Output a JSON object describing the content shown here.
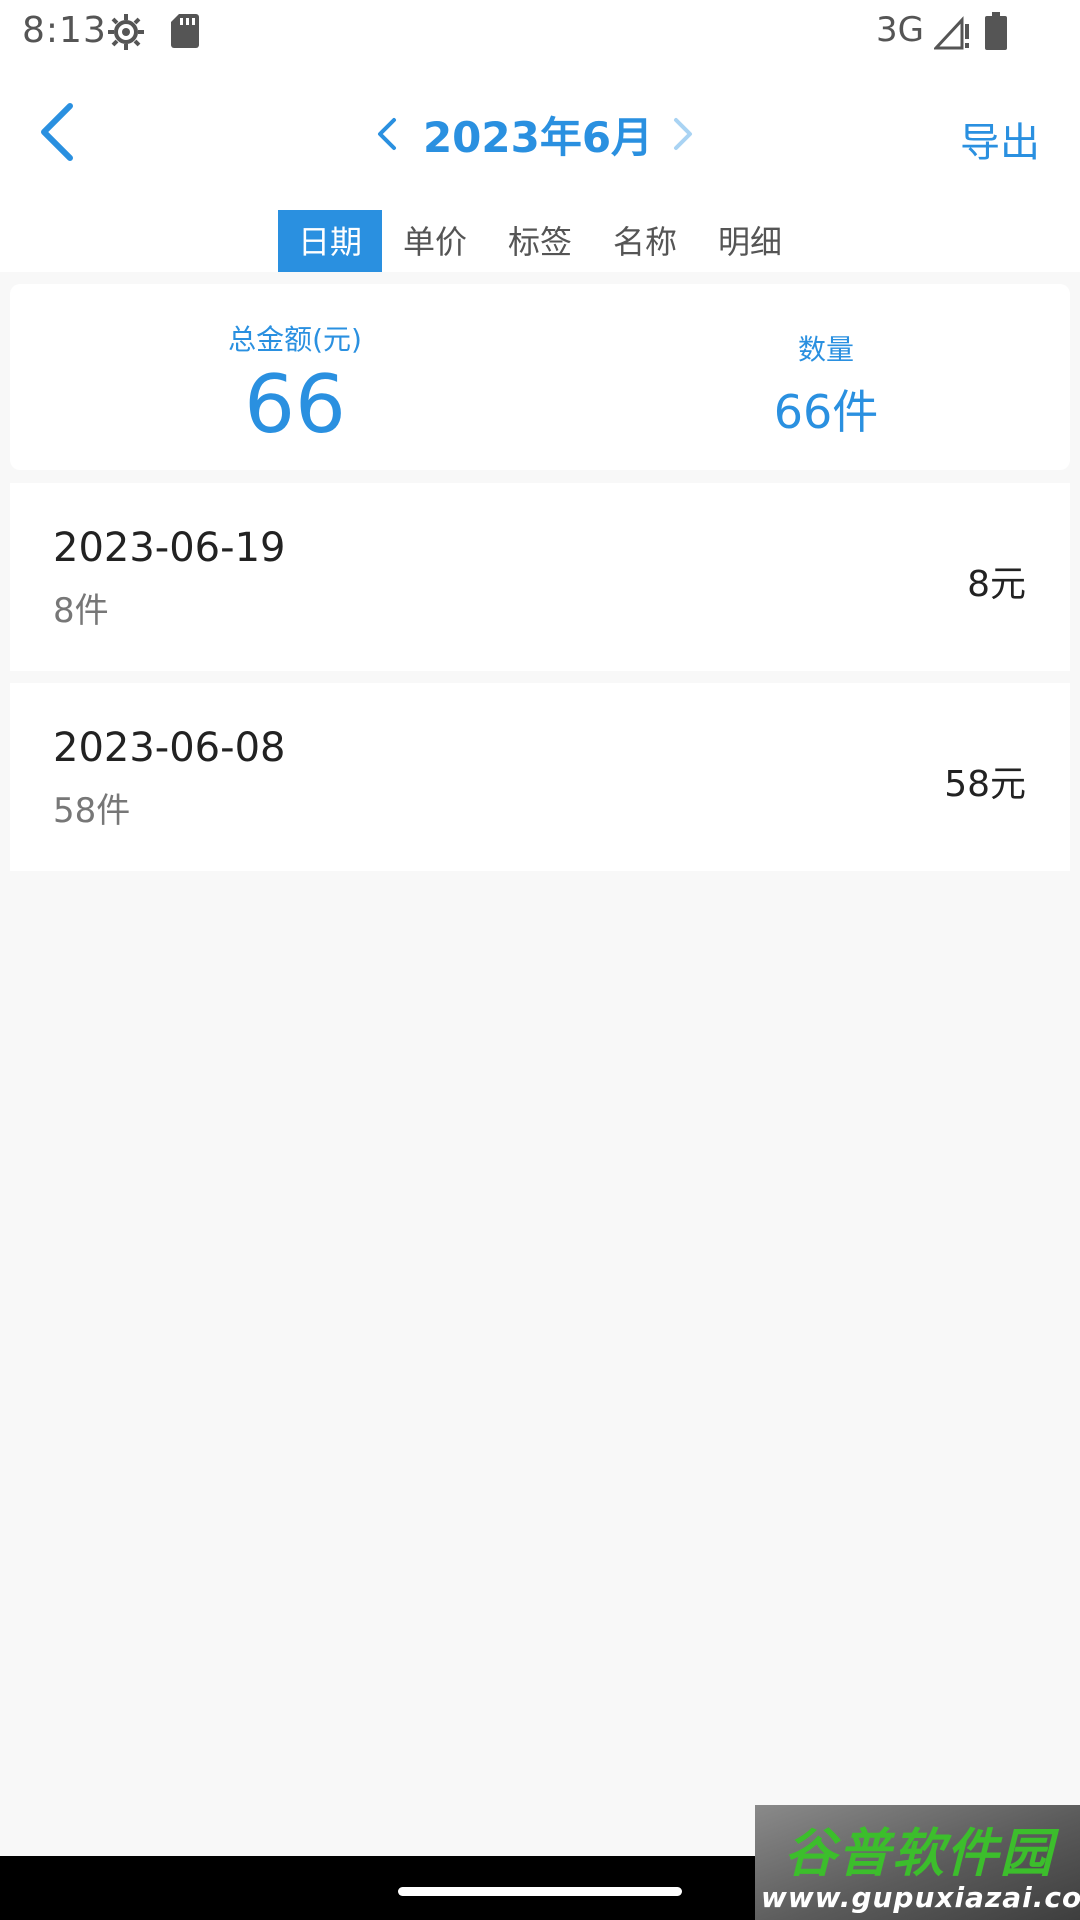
{
  "status_bar": {
    "time": "8:13",
    "network": "3G",
    "icons": [
      "gear-icon",
      "sd-card-icon",
      "signal-icon",
      "battery-icon"
    ]
  },
  "header": {
    "back_icon": "chevron-left-icon",
    "month_title": "2023年6月",
    "export_label": "导出"
  },
  "tabs": [
    {
      "label": "日期",
      "active": true
    },
    {
      "label": "单价",
      "active": false
    },
    {
      "label": "标签",
      "active": false
    },
    {
      "label": "名称",
      "active": false
    },
    {
      "label": "明细",
      "active": false
    }
  ],
  "summary": {
    "amount_label": "总金额(元)",
    "amount_value": "66",
    "count_label": "数量",
    "count_value": "66件"
  },
  "records": [
    {
      "date": "2023-06-19",
      "count": "8件",
      "amount": "8元"
    },
    {
      "date": "2023-06-08",
      "count": "58件",
      "amount": "58元"
    }
  ],
  "watermark": {
    "title": "谷普软件园",
    "url": "www.gupuxiazai.com"
  },
  "colors": {
    "accent": "#2a90e0",
    "background": "#f8f8f8",
    "card": "#ffffff",
    "nav_bar": "#000000"
  }
}
